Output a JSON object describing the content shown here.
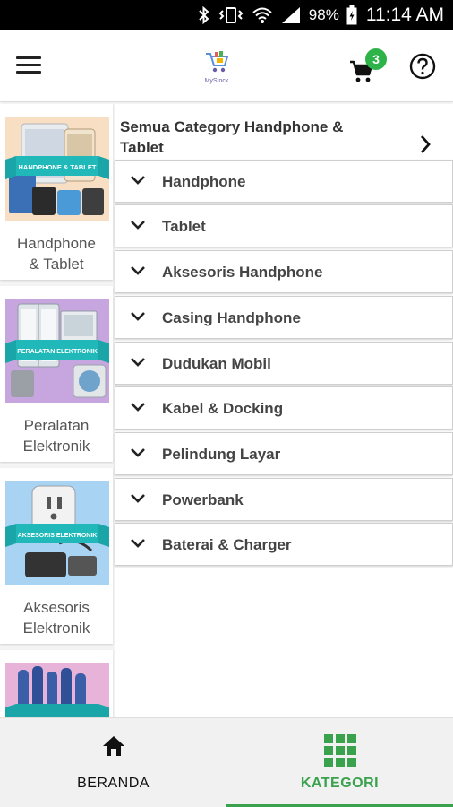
{
  "status_bar": {
    "battery_percent": "98%",
    "time": "11:14 AM"
  },
  "app_bar": {
    "logo_text": "MyStock",
    "cart_count": "3"
  },
  "left_categories": [
    {
      "line1": "Handphone",
      "line2": "& Tablet",
      "banner": "HANDPHONE & TABLET"
    },
    {
      "line1": "Peralatan",
      "line2": "Elektronik",
      "banner": "PERALATAN ELEKTRONIK"
    },
    {
      "line1": "Aksesoris",
      "line2": "Elektronik",
      "banner": "AKSESORIS ELEKTRONIK"
    }
  ],
  "right_panel": {
    "all_label": "Semua Category Handphone & Tablet",
    "subcategories": [
      "Handphone",
      "Tablet",
      "Aksesoris Handphone",
      "Casing Handphone",
      "Dudukan Mobil",
      "Kabel & Docking",
      "Pelindung Layar",
      "Powerbank",
      "Baterai & Charger"
    ]
  },
  "bottom_nav": {
    "home_label": "BERANDA",
    "category_label": "KATEGORI",
    "active": "KATEGORI"
  },
  "colors": {
    "accent_green": "#3aa14d",
    "badge_green": "#2eb34a",
    "banner_teal": "#1aa5a8"
  },
  "icons": {
    "menu": "hamburger-icon",
    "cart": "cart-icon",
    "help": "help-circle-icon",
    "home": "home-icon",
    "category": "grid-icon"
  }
}
